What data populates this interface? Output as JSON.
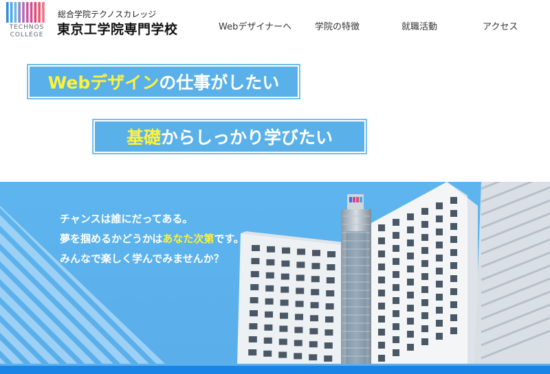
{
  "header": {
    "logo": {
      "word_line1": "TECHNOS",
      "word_line2": "COLLEGE",
      "bar_colors": [
        "#2f8fd6",
        "#4aa8e0",
        "#6db6e6",
        "#8f88c8",
        "#b06cb8",
        "#c85aa0",
        "#d64f8c",
        "#e04a7a",
        "#e85a6e",
        "#f0708a"
      ]
    },
    "school_subtitle": "総合学院テクノスカレッジ",
    "school_name": "東京工学院専門学校"
  },
  "nav": {
    "items": [
      {
        "label": "Webデザイナーへ"
      },
      {
        "label": "学院の特徴"
      },
      {
        "label": "就職活動"
      },
      {
        "label": "アクセス"
      }
    ]
  },
  "banners": {
    "first": {
      "highlight": "Webデザイン",
      "rest": "の仕事がしたい"
    },
    "second": {
      "highlight": "基礎",
      "rest": "からしっかり学びたい"
    }
  },
  "hero": {
    "line1": "チャンスは誰にだってある。",
    "line2_pre": "夢を掴めるかどうかは",
    "line2_highlight": "あなた次第",
    "line2_post": "です。",
    "line3": "みんなで楽しく学んでみませんか？"
  },
  "colors": {
    "banner_bg": "#5ab1ea",
    "highlight": "#fff23a",
    "hero_bg": "#5eb5ee",
    "bottom_bar": "#1a84e6"
  }
}
